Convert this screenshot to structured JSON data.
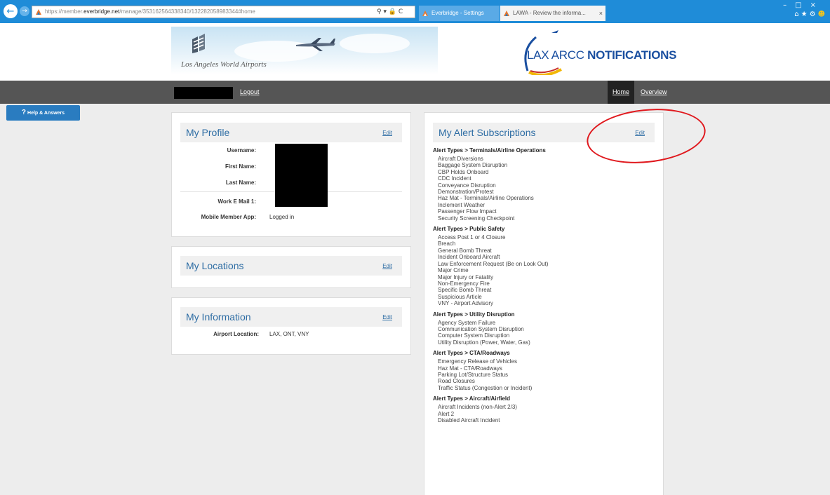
{
  "browser": {
    "url_prefix": "https://member.",
    "url_domain": "everbridge.net",
    "url_suffix": "/manage/353162564338340/132282058983344#home",
    "tabs": [
      {
        "label": "Everbridge - Settings"
      },
      {
        "label": "LAWA - Review the informa..."
      }
    ]
  },
  "header": {
    "org_name": "Los Angeles World Airports",
    "brand_prefix": "LAX ARCC",
    "brand_suffix": " NOTIFICATIONS"
  },
  "nav": {
    "logout": "Logout",
    "home": "Home",
    "overview": "Overview"
  },
  "help": {
    "label": "Help & Answers"
  },
  "profile": {
    "title": "My Profile",
    "edit": "Edit",
    "fields": [
      {
        "label": "Username:",
        "value": ""
      },
      {
        "label": "First Name:",
        "value": ""
      },
      {
        "label": "Last Name:",
        "value": ""
      },
      {
        "label": "Work E Mail 1:",
        "value": ""
      },
      {
        "label": "Mobile Member App:",
        "value": "Logged in"
      }
    ]
  },
  "locations": {
    "title": "My Locations",
    "edit": "Edit"
  },
  "information": {
    "title": "My Information",
    "edit": "Edit",
    "fields": [
      {
        "label": "Airport Location:",
        "value": "LAX, ONT, VNY"
      }
    ]
  },
  "alerts": {
    "title": "My Alert Subscriptions",
    "edit": "Edit",
    "groups": [
      {
        "category": "Alert Types > Terminals/Airline Operations",
        "items": [
          "Aircraft Diversions",
          "Baggage System Disruption",
          "CBP Holds Onboard",
          "CDC Incident",
          "Conveyance Disruption",
          "Demonstration/Protest",
          "Haz Mat - Terminals/Airline Operations",
          "Inclement Weather",
          "Passenger Flow Impact",
          "Security Screening Checkpoint"
        ]
      },
      {
        "category": "Alert Types > Public Safety",
        "items": [
          "Access Post 1 or 4 Closure",
          "Breach",
          "General Bomb Threat",
          "Incident Onboard Aircraft",
          "Law Enforcement Request (Be on Look Out)",
          "Major Crime",
          "Major Injury or Fatality",
          "Non-Emergency Fire",
          "Specific Bomb Threat",
          "Suspicious Article",
          "VNY - Airport Advisory"
        ]
      },
      {
        "category": "Alert Types > Utility Disruption",
        "items": [
          "Agency System Failure",
          "Communication System Disruption",
          "Computer System Disruption",
          "Utility Disruption (Power, Water, Gas)"
        ]
      },
      {
        "category": "Alert Types > CTA/Roadways",
        "items": [
          "Emergency Release of Vehicles",
          "Haz Mat - CTA/Roadways",
          "Parking Lot/Structure Status",
          "Road Closures",
          "Traffic Status (Congestion or Incident)"
        ]
      },
      {
        "category": "Alert Types > Aircraft/Airfield",
        "items": [
          "Aircraft Incidents (non-Alert 2/3)",
          "Alert 2",
          "Disabled Aircraft Incident"
        ]
      }
    ]
  }
}
